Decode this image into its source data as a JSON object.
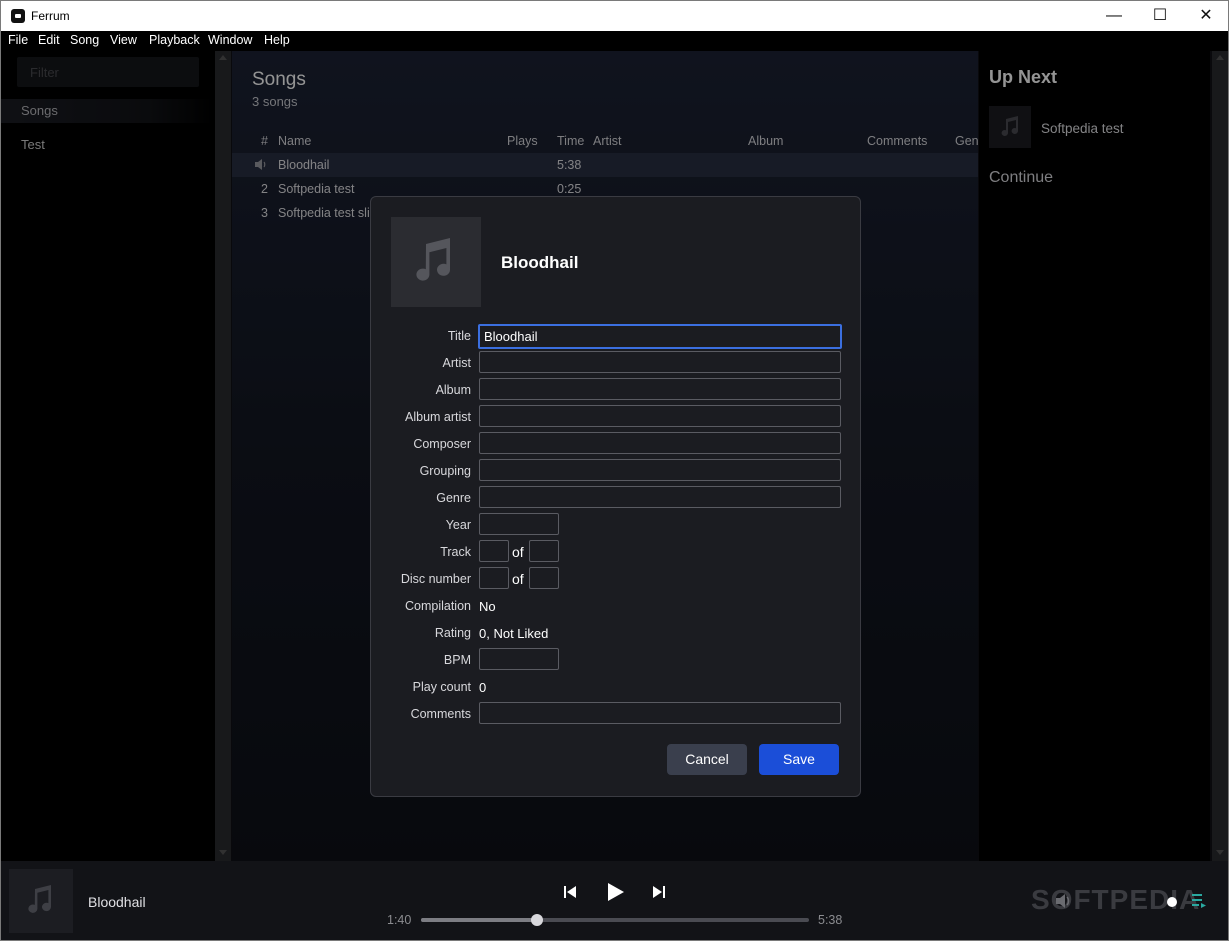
{
  "window": {
    "title": "Ferrum",
    "controls": {
      "minimize": "—",
      "maximize": "☐",
      "close": "✕"
    }
  },
  "menu": [
    "File",
    "Edit",
    "Song",
    "View",
    "Playback",
    "Window",
    "Help"
  ],
  "sidebar": {
    "filter_placeholder": "Filter",
    "items": [
      {
        "label": "Songs",
        "active": true
      },
      {
        "label": "Test",
        "active": false
      }
    ]
  },
  "songs": {
    "title": "Songs",
    "count_label": "3 songs",
    "columns": [
      "#",
      "Name",
      "Plays",
      "Time",
      "Artist",
      "Album",
      "Comments",
      "Gen"
    ],
    "rows": [
      {
        "num": "",
        "name": "Bloodhail",
        "plays": "",
        "time": "5:38",
        "playing": true
      },
      {
        "num": "2",
        "name": "Softpedia test",
        "plays": "",
        "time": "0:25"
      },
      {
        "num": "3",
        "name": "Softpedia test slic",
        "plays": "",
        "time": ""
      }
    ]
  },
  "up_next": {
    "title": "Up Next",
    "items": [
      {
        "name": "Softpedia test"
      }
    ],
    "continue_label": "Continue"
  },
  "player": {
    "track_name": "Bloodhail",
    "elapsed": "1:40",
    "duration": "5:38",
    "progress": 0.3,
    "watermark": "SOFTPEDIA"
  },
  "dialog": {
    "song_title": "Bloodhail",
    "fields": {
      "title": {
        "label": "Title",
        "value": "Bloodhail"
      },
      "artist": {
        "label": "Artist",
        "value": ""
      },
      "album": {
        "label": "Album",
        "value": ""
      },
      "album_artist": {
        "label": "Album artist",
        "value": ""
      },
      "composer": {
        "label": "Composer",
        "value": ""
      },
      "grouping": {
        "label": "Grouping",
        "value": ""
      },
      "genre": {
        "label": "Genre",
        "value": ""
      },
      "year": {
        "label": "Year",
        "value": ""
      },
      "track": {
        "label": "Track",
        "value": "",
        "of_value": ""
      },
      "disc_number": {
        "label": "Disc number",
        "value": "",
        "of_value": ""
      },
      "compilation": {
        "label": "Compilation",
        "value": "No"
      },
      "rating": {
        "label": "Rating",
        "value": "0, Not Liked"
      },
      "bpm": {
        "label": "BPM",
        "value": ""
      },
      "play_count": {
        "label": "Play count",
        "value": "0"
      },
      "comments": {
        "label": "Comments",
        "value": ""
      }
    },
    "of_label": "of",
    "cancel_label": "Cancel",
    "save_label": "Save"
  },
  "colors": {
    "accent": "#1b4ed8",
    "focus": "#3b6fe0",
    "selected_row": "#293043"
  }
}
